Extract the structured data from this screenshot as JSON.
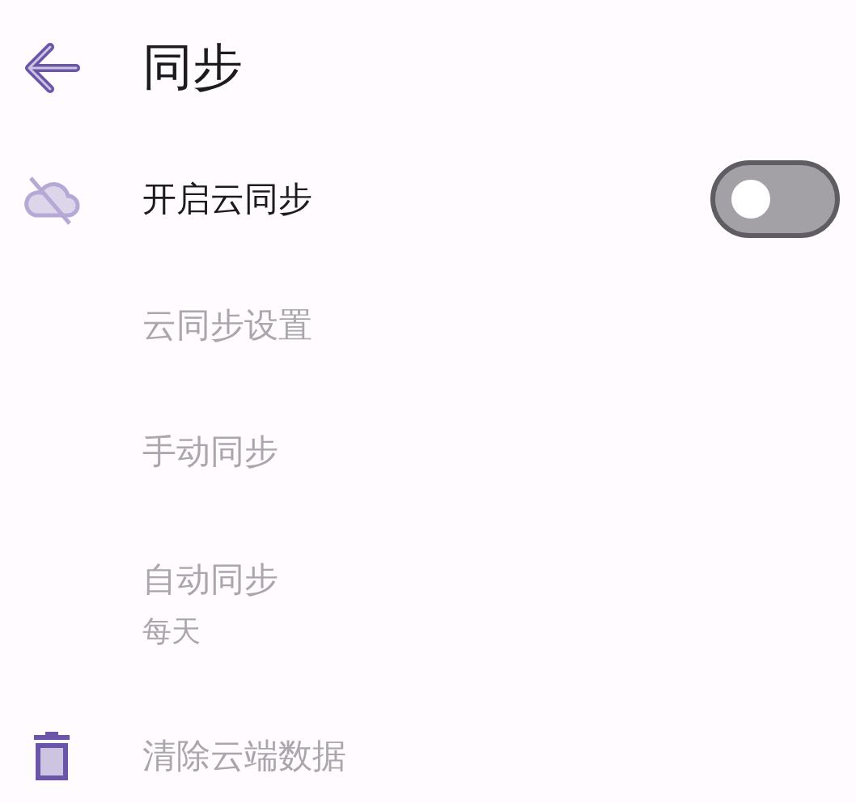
{
  "app_bar": {
    "title": "同步"
  },
  "items": [
    {
      "kind": "switch",
      "label": "开启云同步",
      "disabled": false,
      "on": false
    },
    {
      "kind": "link",
      "label": "云同步设置",
      "disabled": true
    },
    {
      "kind": "link",
      "label": "手动同步",
      "disabled": true
    },
    {
      "kind": "link",
      "label": "自动同步",
      "subtitle": "每天",
      "disabled": true
    },
    {
      "kind": "danger",
      "label": "清除云端数据",
      "disabled": true
    }
  ]
}
